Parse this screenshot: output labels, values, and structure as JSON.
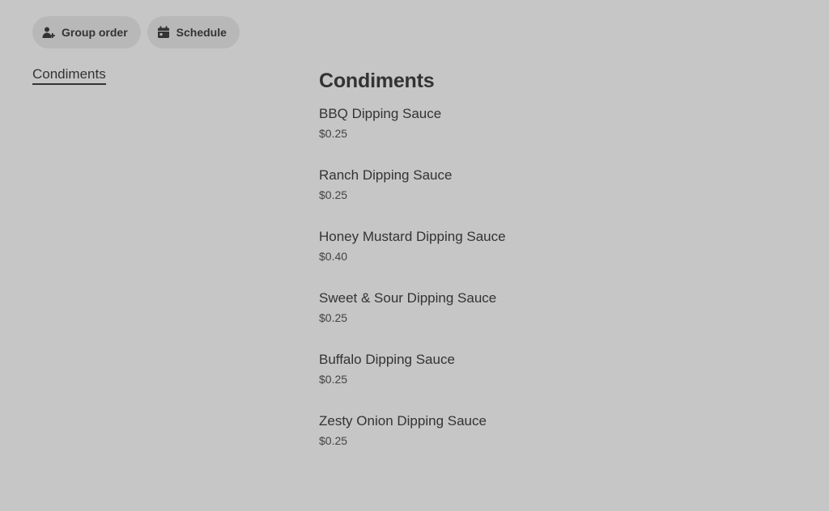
{
  "actions": {
    "group_order": {
      "label": "Group order",
      "icon": "person-add-icon"
    },
    "schedule": {
      "label": "Schedule",
      "icon": "calendar-icon"
    }
  },
  "sidebar": {
    "items": [
      {
        "label": "Condiments",
        "active": true
      }
    ]
  },
  "section": {
    "title": "Condiments",
    "items": [
      {
        "name": "BBQ Dipping Sauce",
        "price": "$0.25"
      },
      {
        "name": "Ranch Dipping Sauce",
        "price": "$0.25"
      },
      {
        "name": "Honey Mustard Dipping Sauce",
        "price": "$0.40"
      },
      {
        "name": "Sweet & Sour Dipping Sauce",
        "price": "$0.25"
      },
      {
        "name": "Buffalo Dipping Sauce",
        "price": "$0.25"
      },
      {
        "name": "Zesty Onion Dipping Sauce",
        "price": "$0.25"
      }
    ]
  },
  "colors": {
    "background": "#c6c6c6",
    "pill": "#b8b8b8",
    "text": "#333333"
  }
}
